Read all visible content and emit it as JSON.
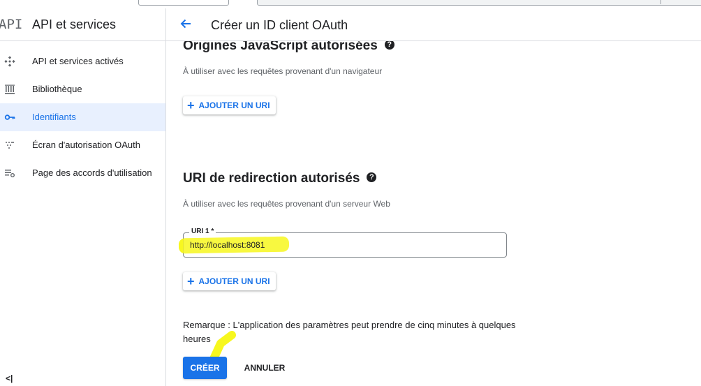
{
  "sidebar": {
    "logo": "API",
    "title": "API et services",
    "items": [
      {
        "label": "API et services activés",
        "icon": "api-diamond-icon"
      },
      {
        "label": "Bibliothèque",
        "icon": "library-icon"
      },
      {
        "label": "Identifiants",
        "icon": "key-icon",
        "active": true
      },
      {
        "label": "Écran d'autorisation OAuth",
        "icon": "consent-dots-icon"
      },
      {
        "label": "Page des accords d'utilisation",
        "icon": "list-settings-icon"
      }
    ],
    "collapse_label": "<|"
  },
  "header": {
    "title": "Créer un ID client OAuth"
  },
  "js_origins": {
    "title": "Origines JavaScript autorisées",
    "help": "?",
    "description": "À utiliser avec les requêtes provenant d'un navigateur",
    "add_label": "AJOUTER UN URI"
  },
  "redirect_uris": {
    "title": "URI de redirection autorisés",
    "help": "?",
    "description": "À utiliser avec les requêtes provenant d'un serveur Web",
    "field_label": "URI 1 *",
    "field_value": "http://localhost:8081",
    "add_label": "AJOUTER UN URI"
  },
  "note": "Remarque : L'application des paramètres peut prendre de cinq minutes à quelques heures",
  "actions": {
    "create_label": "CRÉER",
    "cancel_label": "ANNULER"
  },
  "colors": {
    "accent": "#1a73e8",
    "active_bg": "#e8f0fe",
    "annotation_highlight": "#f7f71e"
  }
}
